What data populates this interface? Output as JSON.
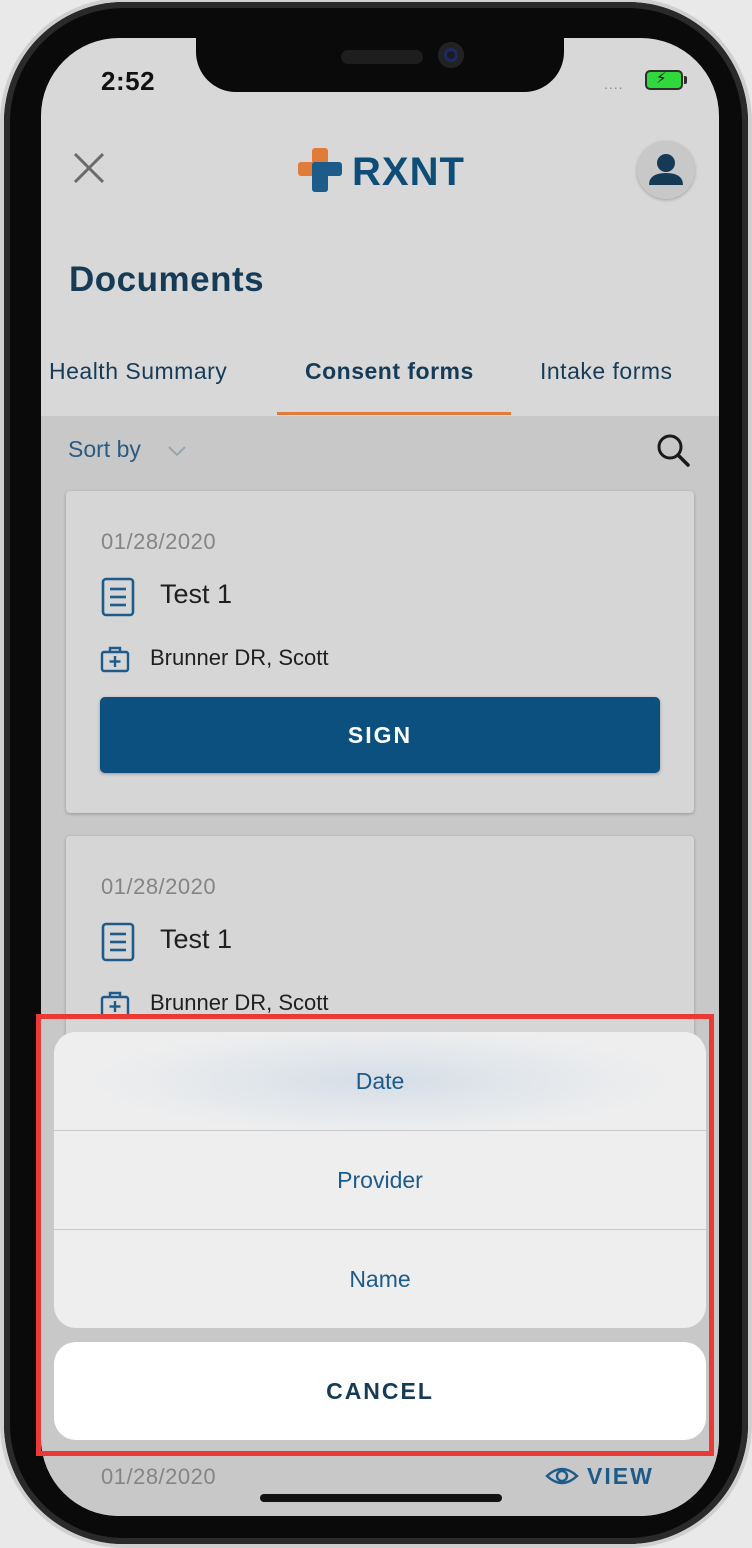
{
  "status_bar": {
    "time": "2:52",
    "signal_dots": "....",
    "accent_battery": "#2fd83b"
  },
  "header": {
    "logo_text": "RXNT",
    "logo_color": "#0e4d78",
    "cross_colors": [
      "#e07b39",
      "#1d5b8a"
    ]
  },
  "page_title": "Documents",
  "tabs": [
    {
      "label": "Health Summary",
      "active": false
    },
    {
      "label": "Consent forms",
      "active": true
    },
    {
      "label": "Intake forms",
      "active": false
    }
  ],
  "tab_accent": "#e07b39",
  "toolbar": {
    "sort_label": "Sort by"
  },
  "cards": [
    {
      "date": "01/28/2020",
      "title": "Test 1",
      "provider": "Brunner DR, Scott",
      "action": "SIGN"
    },
    {
      "date": "01/28/2020",
      "title": "Test 1",
      "provider": "Brunner DR, Scott"
    }
  ],
  "bottom_card": {
    "date": "01/28/2020",
    "view_label": "VIEW"
  },
  "action_sheet": {
    "options": [
      "Date",
      "Provider",
      "Name"
    ],
    "cancel_label": "CANCEL"
  },
  "highlight_color": "#ea3a36"
}
